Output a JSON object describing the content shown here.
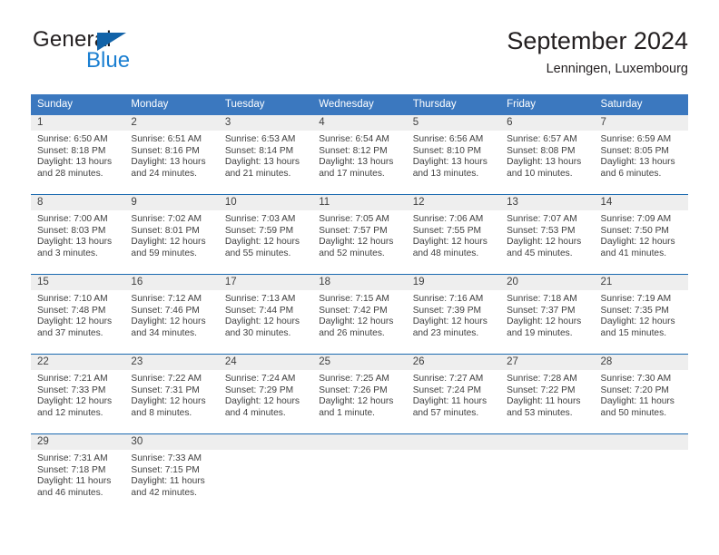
{
  "brand": {
    "name_part1": "General",
    "name_part2": "Blue",
    "triangle_color": "#1263a8",
    "blue_color": "#1b7fd1"
  },
  "header": {
    "title": "September 2024",
    "subtitle": "Lenningen, Luxembourg"
  },
  "theme": {
    "header_bg": "#3b78bf",
    "week_divider": "#1b6ab0",
    "daynum_band": "#eeeeee",
    "text": "#3f3f3f"
  },
  "weekday_headers": [
    "Sunday",
    "Monday",
    "Tuesday",
    "Wednesday",
    "Thursday",
    "Friday",
    "Saturday"
  ],
  "weeks": [
    [
      {
        "day": "1",
        "sunrise": "Sunrise: 6:50 AM",
        "sunset": "Sunset: 8:18 PM",
        "daylight_line1": "Daylight: 13 hours",
        "daylight_line2": "and 28 minutes."
      },
      {
        "day": "2",
        "sunrise": "Sunrise: 6:51 AM",
        "sunset": "Sunset: 8:16 PM",
        "daylight_line1": "Daylight: 13 hours",
        "daylight_line2": "and 24 minutes."
      },
      {
        "day": "3",
        "sunrise": "Sunrise: 6:53 AM",
        "sunset": "Sunset: 8:14 PM",
        "daylight_line1": "Daylight: 13 hours",
        "daylight_line2": "and 21 minutes."
      },
      {
        "day": "4",
        "sunrise": "Sunrise: 6:54 AM",
        "sunset": "Sunset: 8:12 PM",
        "daylight_line1": "Daylight: 13 hours",
        "daylight_line2": "and 17 minutes."
      },
      {
        "day": "5",
        "sunrise": "Sunrise: 6:56 AM",
        "sunset": "Sunset: 8:10 PM",
        "daylight_line1": "Daylight: 13 hours",
        "daylight_line2": "and 13 minutes."
      },
      {
        "day": "6",
        "sunrise": "Sunrise: 6:57 AM",
        "sunset": "Sunset: 8:08 PM",
        "daylight_line1": "Daylight: 13 hours",
        "daylight_line2": "and 10 minutes."
      },
      {
        "day": "7",
        "sunrise": "Sunrise: 6:59 AM",
        "sunset": "Sunset: 8:05 PM",
        "daylight_line1": "Daylight: 13 hours",
        "daylight_line2": "and 6 minutes."
      }
    ],
    [
      {
        "day": "8",
        "sunrise": "Sunrise: 7:00 AM",
        "sunset": "Sunset: 8:03 PM",
        "daylight_line1": "Daylight: 13 hours",
        "daylight_line2": "and 3 minutes."
      },
      {
        "day": "9",
        "sunrise": "Sunrise: 7:02 AM",
        "sunset": "Sunset: 8:01 PM",
        "daylight_line1": "Daylight: 12 hours",
        "daylight_line2": "and 59 minutes."
      },
      {
        "day": "10",
        "sunrise": "Sunrise: 7:03 AM",
        "sunset": "Sunset: 7:59 PM",
        "daylight_line1": "Daylight: 12 hours",
        "daylight_line2": "and 55 minutes."
      },
      {
        "day": "11",
        "sunrise": "Sunrise: 7:05 AM",
        "sunset": "Sunset: 7:57 PM",
        "daylight_line1": "Daylight: 12 hours",
        "daylight_line2": "and 52 minutes."
      },
      {
        "day": "12",
        "sunrise": "Sunrise: 7:06 AM",
        "sunset": "Sunset: 7:55 PM",
        "daylight_line1": "Daylight: 12 hours",
        "daylight_line2": "and 48 minutes."
      },
      {
        "day": "13",
        "sunrise": "Sunrise: 7:07 AM",
        "sunset": "Sunset: 7:53 PM",
        "daylight_line1": "Daylight: 12 hours",
        "daylight_line2": "and 45 minutes."
      },
      {
        "day": "14",
        "sunrise": "Sunrise: 7:09 AM",
        "sunset": "Sunset: 7:50 PM",
        "daylight_line1": "Daylight: 12 hours",
        "daylight_line2": "and 41 minutes."
      }
    ],
    [
      {
        "day": "15",
        "sunrise": "Sunrise: 7:10 AM",
        "sunset": "Sunset: 7:48 PM",
        "daylight_line1": "Daylight: 12 hours",
        "daylight_line2": "and 37 minutes."
      },
      {
        "day": "16",
        "sunrise": "Sunrise: 7:12 AM",
        "sunset": "Sunset: 7:46 PM",
        "daylight_line1": "Daylight: 12 hours",
        "daylight_line2": "and 34 minutes."
      },
      {
        "day": "17",
        "sunrise": "Sunrise: 7:13 AM",
        "sunset": "Sunset: 7:44 PM",
        "daylight_line1": "Daylight: 12 hours",
        "daylight_line2": "and 30 minutes."
      },
      {
        "day": "18",
        "sunrise": "Sunrise: 7:15 AM",
        "sunset": "Sunset: 7:42 PM",
        "daylight_line1": "Daylight: 12 hours",
        "daylight_line2": "and 26 minutes."
      },
      {
        "day": "19",
        "sunrise": "Sunrise: 7:16 AM",
        "sunset": "Sunset: 7:39 PM",
        "daylight_line1": "Daylight: 12 hours",
        "daylight_line2": "and 23 minutes."
      },
      {
        "day": "20",
        "sunrise": "Sunrise: 7:18 AM",
        "sunset": "Sunset: 7:37 PM",
        "daylight_line1": "Daylight: 12 hours",
        "daylight_line2": "and 19 minutes."
      },
      {
        "day": "21",
        "sunrise": "Sunrise: 7:19 AM",
        "sunset": "Sunset: 7:35 PM",
        "daylight_line1": "Daylight: 12 hours",
        "daylight_line2": "and 15 minutes."
      }
    ],
    [
      {
        "day": "22",
        "sunrise": "Sunrise: 7:21 AM",
        "sunset": "Sunset: 7:33 PM",
        "daylight_line1": "Daylight: 12 hours",
        "daylight_line2": "and 12 minutes."
      },
      {
        "day": "23",
        "sunrise": "Sunrise: 7:22 AM",
        "sunset": "Sunset: 7:31 PM",
        "daylight_line1": "Daylight: 12 hours",
        "daylight_line2": "and 8 minutes."
      },
      {
        "day": "24",
        "sunrise": "Sunrise: 7:24 AM",
        "sunset": "Sunset: 7:29 PM",
        "daylight_line1": "Daylight: 12 hours",
        "daylight_line2": "and 4 minutes."
      },
      {
        "day": "25",
        "sunrise": "Sunrise: 7:25 AM",
        "sunset": "Sunset: 7:26 PM",
        "daylight_line1": "Daylight: 12 hours",
        "daylight_line2": "and 1 minute."
      },
      {
        "day": "26",
        "sunrise": "Sunrise: 7:27 AM",
        "sunset": "Sunset: 7:24 PM",
        "daylight_line1": "Daylight: 11 hours",
        "daylight_line2": "and 57 minutes."
      },
      {
        "day": "27",
        "sunrise": "Sunrise: 7:28 AM",
        "sunset": "Sunset: 7:22 PM",
        "daylight_line1": "Daylight: 11 hours",
        "daylight_line2": "and 53 minutes."
      },
      {
        "day": "28",
        "sunrise": "Sunrise: 7:30 AM",
        "sunset": "Sunset: 7:20 PM",
        "daylight_line1": "Daylight: 11 hours",
        "daylight_line2": "and 50 minutes."
      }
    ],
    [
      {
        "day": "29",
        "sunrise": "Sunrise: 7:31 AM",
        "sunset": "Sunset: 7:18 PM",
        "daylight_line1": "Daylight: 11 hours",
        "daylight_line2": "and 46 minutes."
      },
      {
        "day": "30",
        "sunrise": "Sunrise: 7:33 AM",
        "sunset": "Sunset: 7:15 PM",
        "daylight_line1": "Daylight: 11 hours",
        "daylight_line2": "and 42 minutes."
      },
      {
        "day": "",
        "sunrise": "",
        "sunset": "",
        "daylight_line1": "",
        "daylight_line2": ""
      },
      {
        "day": "",
        "sunrise": "",
        "sunset": "",
        "daylight_line1": "",
        "daylight_line2": ""
      },
      {
        "day": "",
        "sunrise": "",
        "sunset": "",
        "daylight_line1": "",
        "daylight_line2": ""
      },
      {
        "day": "",
        "sunrise": "",
        "sunset": "",
        "daylight_line1": "",
        "daylight_line2": ""
      },
      {
        "day": "",
        "sunrise": "",
        "sunset": "",
        "daylight_line1": "",
        "daylight_line2": ""
      }
    ]
  ]
}
